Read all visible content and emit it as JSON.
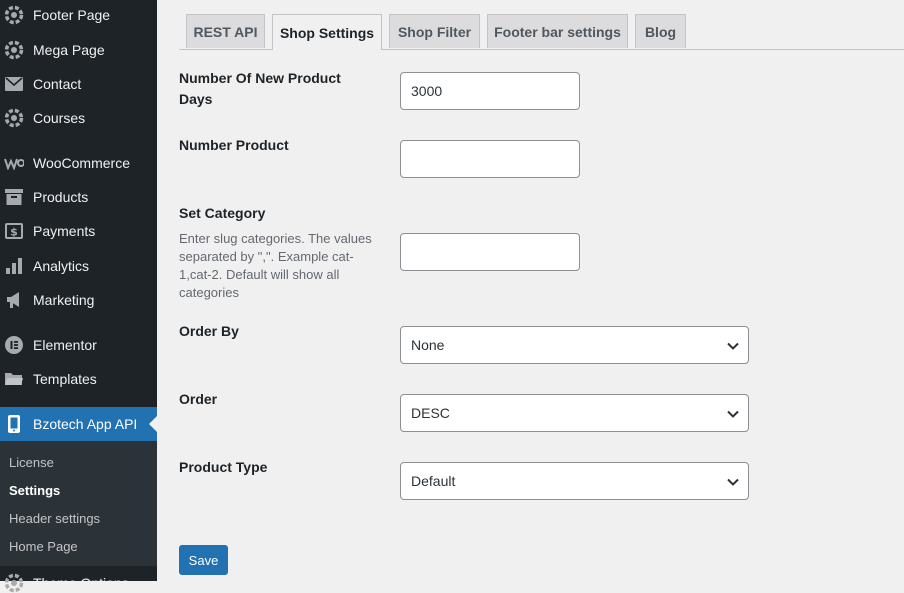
{
  "sidebar": {
    "items": [
      {
        "label": "Footer Page",
        "icon": "gear-logo-icon"
      },
      {
        "label": "Mega Page",
        "icon": "gear-logo-icon"
      },
      {
        "label": "Contact",
        "icon": "envelope-icon"
      },
      {
        "label": "Courses",
        "icon": "gear-logo-icon"
      },
      {
        "label": "WooCommerce",
        "icon": "woocommerce-icon"
      },
      {
        "label": "Products",
        "icon": "archive-icon"
      },
      {
        "label": "Payments",
        "icon": "dollar-card-icon"
      },
      {
        "label": "Analytics",
        "icon": "bar-chart-icon"
      },
      {
        "label": "Marketing",
        "icon": "megaphone-icon"
      },
      {
        "label": "Elementor",
        "icon": "elementor-icon"
      },
      {
        "label": "Templates",
        "icon": "folder-icon"
      },
      {
        "label": "Bzotech App API",
        "icon": "phone-icon"
      }
    ],
    "submenu": [
      "License",
      "Settings",
      "Header settings",
      "Home Page"
    ],
    "partial_item": "Theme Options"
  },
  "tabs": [
    "REST API",
    "Shop Settings",
    "Shop Filter",
    "Footer bar settings",
    "Blog"
  ],
  "active_tab": "Shop Settings",
  "form": {
    "new_product_days": {
      "label": "Number Of New Product Days",
      "value": "3000"
    },
    "number_product": {
      "label": "Number Product",
      "value": ""
    },
    "set_category": {
      "label": "Set Category",
      "description": "Enter slug categories. The values separated by \",\". Example cat-1,cat-2. Default will show all categories",
      "value": ""
    },
    "order_by": {
      "label": "Order By",
      "value": "None"
    },
    "order": {
      "label": "Order",
      "value": "DESC"
    },
    "product_type": {
      "label": "Product Type",
      "value": "Default"
    }
  },
  "save_label": "Save",
  "colors": {
    "sidebar_bg": "#1d2327",
    "active_menu": "#2271b1",
    "submenu_bg": "#2c3338",
    "page_bg": "#f0f0f1",
    "primary_button": "#2271b1"
  }
}
